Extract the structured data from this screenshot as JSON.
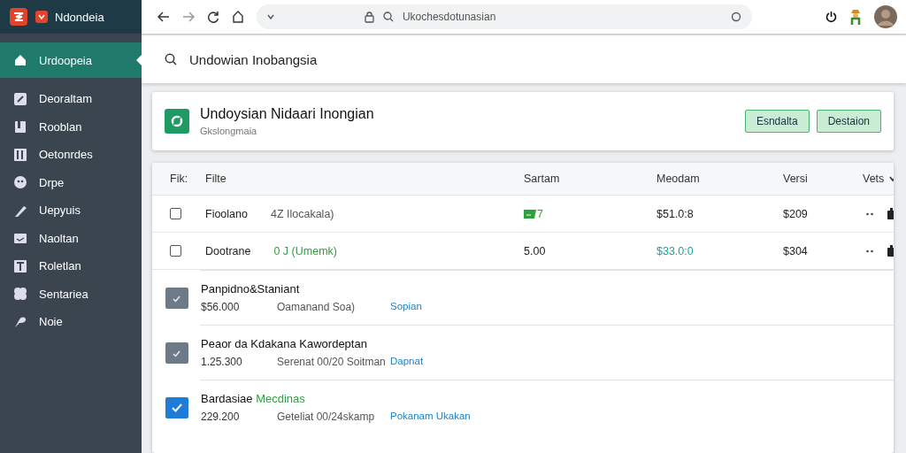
{
  "sidebar": {
    "brand": "Ndondeia",
    "items": [
      {
        "label": "Urdoopeia",
        "selected": true
      },
      {
        "label": "Deoraltam",
        "selected": false
      },
      {
        "label": "Rooblan",
        "selected": false
      },
      {
        "label": "Oetonrdes",
        "selected": false
      },
      {
        "label": "Drpe",
        "selected": false
      },
      {
        "label": "Uepyuis",
        "selected": false
      },
      {
        "label": "Naoltan",
        "selected": false
      },
      {
        "label": "Roletlan",
        "selected": false
      },
      {
        "label": "Sentariea",
        "selected": false
      },
      {
        "label": "Noie",
        "selected": false
      }
    ]
  },
  "browser": {
    "address": "Ukochesdotunasian"
  },
  "search": {
    "value": "Undowian Inobangsia"
  },
  "header": {
    "title": "Undoysian Nidaari Inongian",
    "subtitle": "Gkslongmaia",
    "buttons": [
      "Esndalta",
      "Destaion"
    ]
  },
  "table": {
    "columns": [
      "Fik:",
      "Filte",
      "Sartam",
      "Meodam",
      "Versi",
      "Vets"
    ],
    "rows": [
      {
        "checked": false,
        "name": "Fioolano",
        "note": "4Z Ilocakala)",
        "note_positive": false,
        "flag": true,
        "sartam": "7",
        "meodam": "$51.0:8",
        "meodam_accent": false,
        "versi": "$209"
      },
      {
        "checked": false,
        "name": "Dootrane",
        "note": "0 J (Umemk)",
        "note_positive": true,
        "flag": false,
        "sartam": "5.00",
        "meodam": "$33.0:0",
        "meodam_accent": true,
        "versi": "$304"
      }
    ],
    "items": [
      {
        "checked": true,
        "disabled": true,
        "title": "Panpidno&Staniant",
        "amount": "$56.000",
        "detail": "Oamanand Soa)",
        "link": "Sopian"
      },
      {
        "checked": true,
        "disabled": true,
        "title": "Peaor da Kdakana Kawordeptan",
        "amount": "1.25.300",
        "detail": "Serenat 00/20 Soitman",
        "link": "Dapnat"
      },
      {
        "checked": true,
        "disabled": false,
        "title": "Bardasiae",
        "tag": "Mecdinas",
        "amount": "229.200",
        "detail": "Geteliat 00/24skamp",
        "link": "Pokanam Ukakan"
      }
    ]
  }
}
